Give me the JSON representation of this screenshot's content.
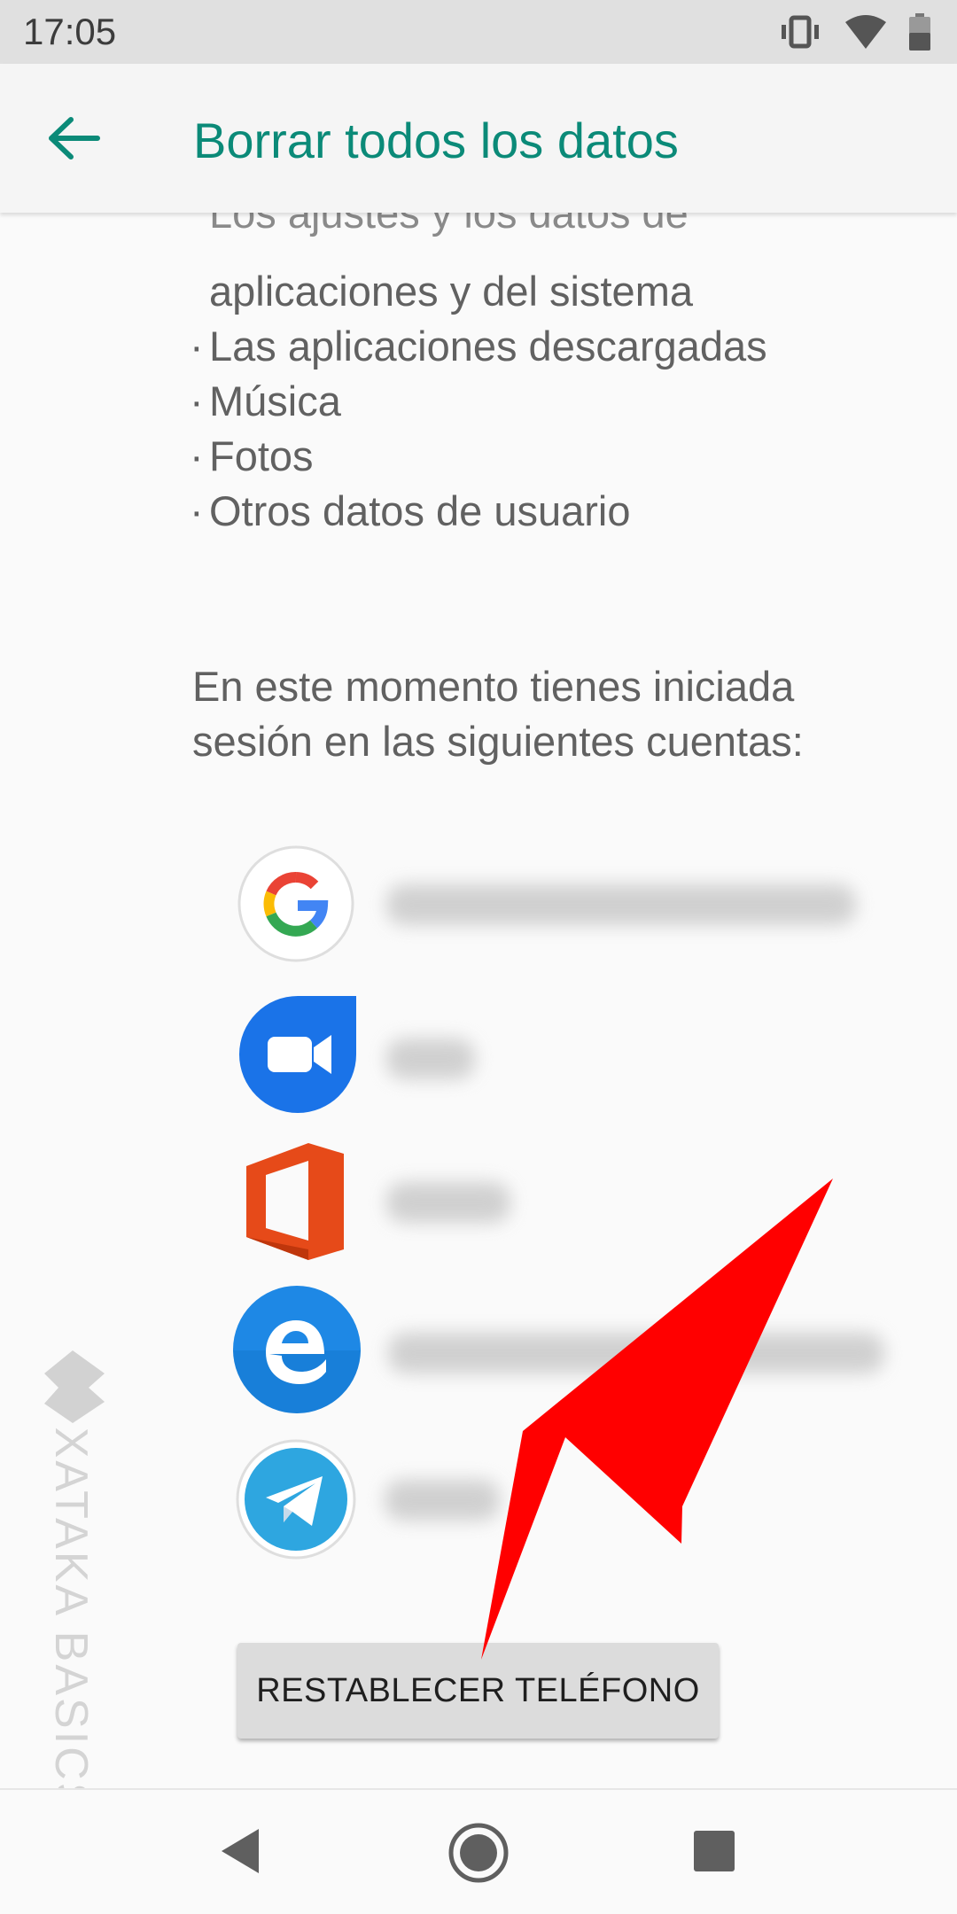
{
  "status_bar": {
    "time": "17:05",
    "icons": [
      "vibrate-icon",
      "wifi-icon",
      "battery-icon"
    ]
  },
  "app_bar": {
    "title": "Borrar todos los datos",
    "back_icon": "arrow-back-icon"
  },
  "content": {
    "list_items": [
      "Los ajustes y los datos de",
      "aplicaciones y del sistema",
      "Las aplicaciones descargadas",
      "Música",
      "Fotos",
      "Otros datos de usuario"
    ],
    "accounts_intro": [
      "En este momento tienes iniciada",
      "sesión en las siguientes cuentas:"
    ],
    "accounts": [
      {
        "app": "Google",
        "icon": "google-icon"
      },
      {
        "app": "Duo",
        "icon": "duo-icon"
      },
      {
        "app": "Office",
        "icon": "office-icon"
      },
      {
        "app": "Edge",
        "icon": "edge-icon"
      },
      {
        "app": "Telegram",
        "icon": "telegram-icon"
      }
    ]
  },
  "reset_button": {
    "label": "RESTABLECER TELÉFONO"
  },
  "watermark": {
    "text": "XATAKA BASICS"
  },
  "nav_bar": {
    "items": [
      "back-nav-icon",
      "home-nav-icon",
      "recents-nav-icon"
    ]
  },
  "colors": {
    "accent": "#0b8a78",
    "arrow": "#ff0000",
    "text": "#616161",
    "button_bg": "#dcdcdc"
  }
}
